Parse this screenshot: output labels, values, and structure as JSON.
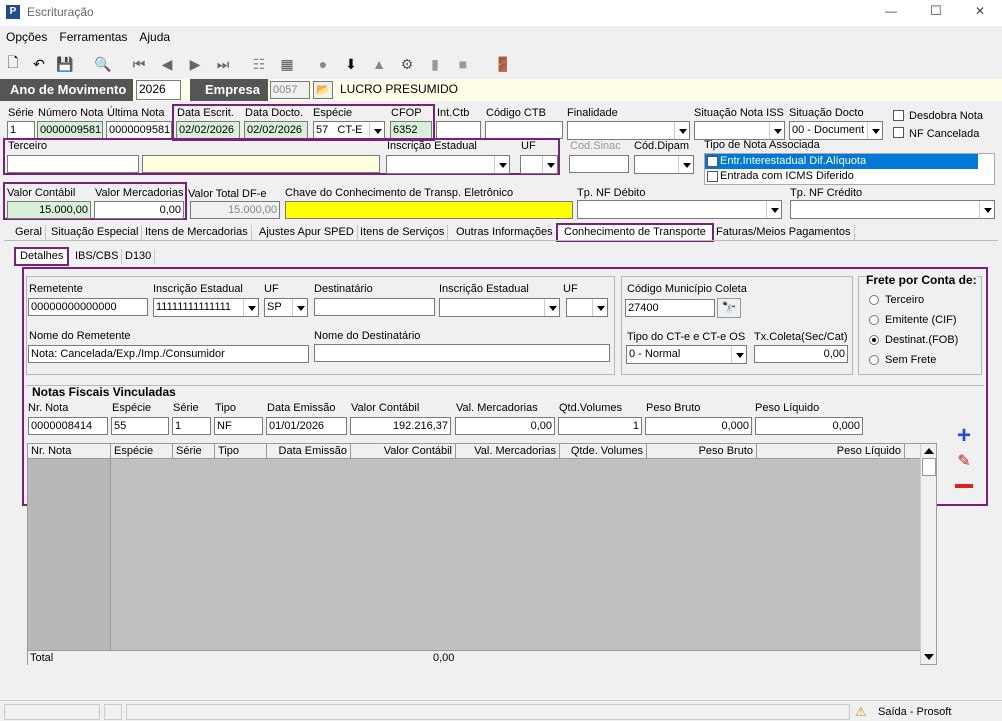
{
  "window": {
    "title": "Escrituração",
    "min": "—",
    "max": "☐",
    "close": "✕"
  },
  "menu": [
    "Opções",
    "Ferramentas",
    "Ajuda"
  ],
  "ano": {
    "label": "Ano de Movimento",
    "value": "2026",
    "empresa_label": "Empresa",
    "empresa_code": "0057",
    "empresa_name": "LUCRO PRESUMIDO"
  },
  "row1": {
    "serie_label": "Série",
    "serie": "1",
    "numero_label": "Número Nota",
    "numero": "0000009581",
    "ultima_label": "Última Nota",
    "ultima": "0000009581",
    "data_escrit_label": "Data Escrit.",
    "data_escrit": "02/02/2026",
    "data_docto_label": "Data Docto.",
    "data_docto": "02/02/2026",
    "especie_label": "Espécie",
    "especie": "57",
    "especie_sel": "CT-E",
    "cfop_label": "CFOP",
    "cfop": "6352",
    "intctb_label": "Int.Ctb",
    "codctb_label": "Código CTB",
    "finalidade_label": "Finalidade",
    "sit_iss_label": "Situação Nota ISS",
    "sit_docto_label": "Situação Docto",
    "sit_docto": "00 - Document",
    "desdobra": "Desdobra Nota",
    "nf_cancelada": "NF Cancelada"
  },
  "row2": {
    "terceiro_label": "Terceiro",
    "ie_label": "Inscrição Estadual",
    "uf_label": "UF",
    "codsinac_label": "Cod.Sinac",
    "coddipam_label": "Cód.Dipam",
    "tipo_nota_label": "Tipo de Nota Associada",
    "tipo_opts": [
      "Entr.Interestadual Dif.Alíquota",
      "Entrada com ICMS Diferido"
    ]
  },
  "row3": {
    "valor_contabil_label": "Valor Contábil",
    "valor_contabil": "15.000,00",
    "valor_merc_label": "Valor Mercadorias",
    "valor_merc": "0,00",
    "valor_total_label": "Valor Total DF-e",
    "valor_total": "15.000,00",
    "chave_label": "Chave do Conhecimento de Transp. Eletrônico",
    "tp_debito_label": "Tp. NF Débito",
    "tp_credito_label": "Tp. NF Crédito"
  },
  "tabs": [
    "Geral",
    "Situação Especial",
    "Itens de Mercadorias",
    "Ajustes Apur SPED",
    "Itens de Serviços",
    "Outras Informações",
    "Conhecimento de Transporte",
    "Faturas/Meios Pagamentos"
  ],
  "subtabs": [
    "Detalhes",
    "IBS/CBS",
    "D130"
  ],
  "transp": {
    "remetente_label": "Remetente",
    "remetente": "00000000000000",
    "ie_label": "Inscrição Estadual",
    "ie": "11111111111111",
    "uf_label": "UF",
    "uf": "SP",
    "dest_label": "Destinatário",
    "ie2_label": "Inscrição Estadual",
    "uf2_label": "UF",
    "nome_rem_label": "Nome do Remetente",
    "nome_rem": "Nota: Cancelada/Exp./Imp./Consumidor",
    "nome_dest_label": "Nome do Destinatário",
    "cod_mun_label": "Código Município Coleta",
    "cod_mun": "27400",
    "tipo_cte_label": "Tipo do CT-e e CT-e OS",
    "tipo_cte": "0 - Normal",
    "tx_coleta_label": "Tx.Coleta(Sec/Cat)",
    "tx_coleta": "0,00",
    "frete_label": "Frete por Conta de:",
    "frete_opts": [
      "Terceiro",
      "Emitente (CIF)",
      "Destinat.(FOB)",
      "Sem Frete"
    ]
  },
  "nf": {
    "title": "Notas Fiscais Vinculadas",
    "labels": [
      "Nr. Nota",
      "Espécie",
      "Série",
      "Tipo",
      "Data Emissão",
      "Valor Contábil",
      "Val. Mercadorias",
      "Qtd.Volumes",
      "Peso Bruto",
      "Peso Líquido"
    ],
    "values": [
      "0000008414",
      "55",
      "1",
      "NF",
      "01/01/2026",
      "192.216,37",
      "0,00",
      "1",
      "0,000",
      "0,000"
    ],
    "grid_headers": [
      "Nr. Nota",
      "Espécie",
      "Série",
      "Tipo",
      "Data Emissão",
      "Valor Contábil",
      "Val. Mercadorias",
      "Qtde. Volumes",
      "Peso Bruto",
      "Peso Líquido"
    ],
    "total_label": "Total",
    "total_value": "0,00"
  },
  "status": {
    "text": "Saída - Prosoft"
  }
}
